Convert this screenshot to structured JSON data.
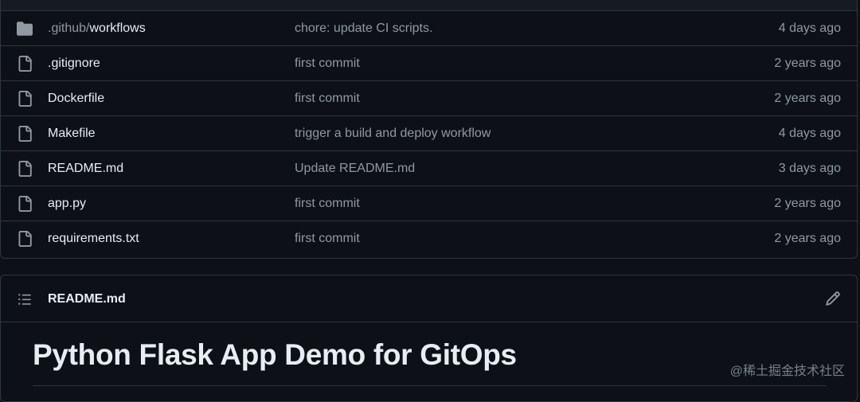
{
  "files": [
    {
      "icon": "folder-icon",
      "name_prefix": ".github/",
      "name": "workflows",
      "message": "chore: update CI scripts.",
      "time": "4 days ago"
    },
    {
      "icon": "file-icon",
      "name_prefix": "",
      "name": ".gitignore",
      "message": "first commit",
      "time": "2 years ago"
    },
    {
      "icon": "file-icon",
      "name_prefix": "",
      "name": "Dockerfile",
      "message": "first commit",
      "time": "2 years ago"
    },
    {
      "icon": "file-icon",
      "name_prefix": "",
      "name": "Makefile",
      "message": "trigger a build and deploy workflow",
      "time": "4 days ago"
    },
    {
      "icon": "file-icon",
      "name_prefix": "",
      "name": "README.md",
      "message": "Update README.md",
      "time": "3 days ago"
    },
    {
      "icon": "file-icon",
      "name_prefix": "",
      "name": "app.py",
      "message": "first commit",
      "time": "2 years ago"
    },
    {
      "icon": "file-icon",
      "name_prefix": "",
      "name": "requirements.txt",
      "message": "first commit",
      "time": "2 years ago"
    }
  ],
  "readme": {
    "list_icon": "list-unordered-icon",
    "title": "README.md",
    "edit_icon": "pencil-icon",
    "heading": "Python Flask App Demo for GitOps"
  },
  "watermark": "@稀土掘金技术社区",
  "colors": {
    "background": "#0d1117",
    "border": "#30363d",
    "text_primary": "#e6edf3",
    "text_muted": "#9198a1"
  }
}
